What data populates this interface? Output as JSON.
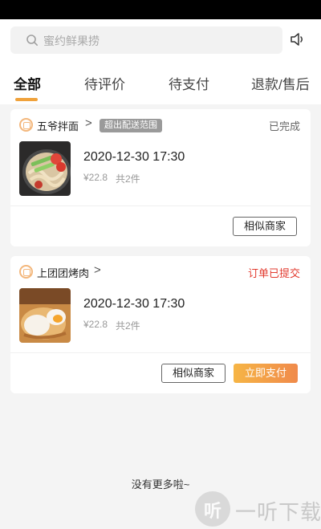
{
  "search": {
    "placeholder": "蜜约鲜果捞"
  },
  "tabs": [
    {
      "label": "全部",
      "active": true
    },
    {
      "label": "待评价",
      "active": false
    },
    {
      "label": "待支付",
      "active": false
    },
    {
      "label": "退款/售后",
      "active": false
    }
  ],
  "orders": [
    {
      "shop_name": "五爷拌面",
      "badge": "超出配送范围",
      "status": "已完成",
      "status_color": "#666666",
      "time": "2020-12-30  17:30",
      "price": "¥22.8",
      "count": "共2件",
      "buttons": [
        "相似商家"
      ]
    },
    {
      "shop_name": "上团团烤肉",
      "badge": "",
      "status": "订单已提交",
      "status_color": "#e23b2f",
      "time": "2020-12-30  17:30",
      "price": "¥22.8",
      "count": "共2件",
      "buttons": [
        "相似商家",
        "立即支付"
      ]
    }
  ],
  "footer": {
    "no_more": "没有更多啦~"
  },
  "watermark": {
    "logo_text": "听",
    "text": "一听下载"
  },
  "colors": {
    "accent": "#f0a23b",
    "pay_button_start": "#f6b545",
    "pay_button_end": "#f08a4b",
    "status_red": "#e23b2f"
  },
  "icons": [
    "search-icon",
    "speaker-icon",
    "shop-icon",
    "chevron-right-icon"
  ]
}
